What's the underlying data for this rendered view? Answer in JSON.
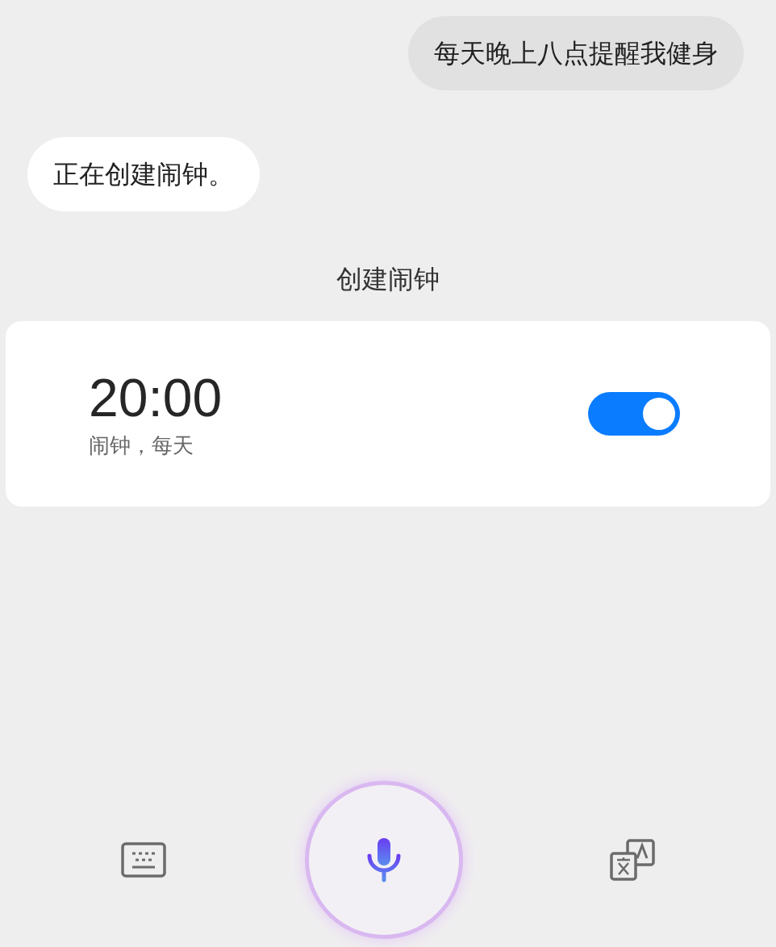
{
  "messages": [
    {
      "kind": "sent",
      "text": "每天晚上八点提醒我健身"
    },
    {
      "kind": "received",
      "text": "正在创建闹钟。"
    }
  ],
  "card_title": "创建闹钟",
  "alarm": {
    "time": "20:00",
    "detail": "闹钟，每天",
    "on": true
  }
}
